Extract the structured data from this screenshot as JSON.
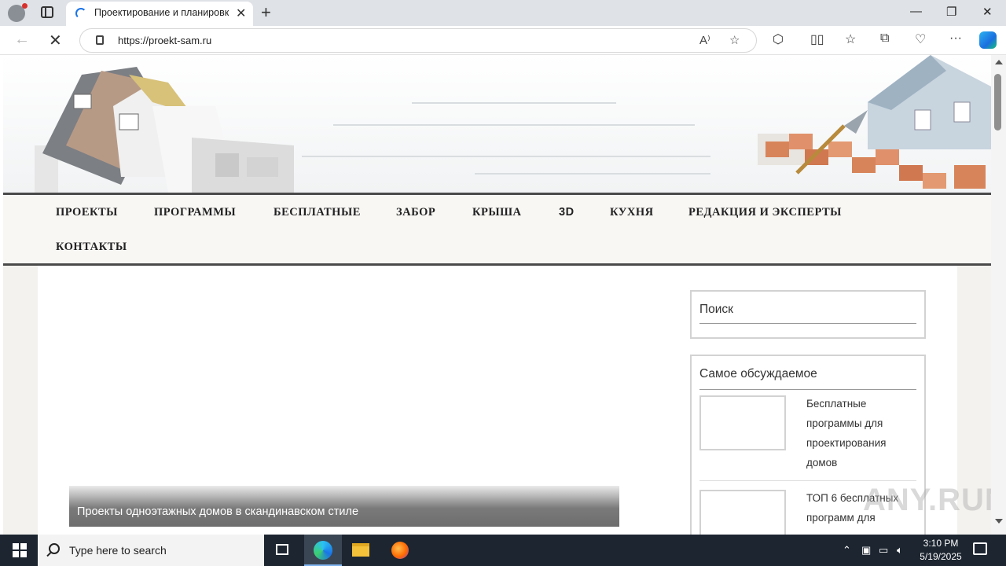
{
  "browser": {
    "tab_title": "Проектирование и планировка",
    "url": "https://proekt-sam.ru"
  },
  "menu": {
    "items": [
      "ПРОЕКТЫ",
      "ПРОГРАММЫ",
      "БЕСПЛАТНЫЕ",
      "ЗАБОР",
      "КРЫША",
      "3D",
      "КУХНЯ",
      "РЕДАКЦИЯ И ЭКСПЕРТЫ",
      "КОНТАКТЫ"
    ]
  },
  "slider": {
    "caption": "Проекты одноэтажных домов в скандинавском стиле"
  },
  "sidebar": {
    "search_title": "Поиск",
    "discussed_title": "Самое обсуждаемое",
    "posts": [
      "Бесплатные программы для проектирования домов",
      "ТОП 6 бесплатных программ для"
    ]
  },
  "watermark": "ANY.RUN",
  "taskbar": {
    "search_placeholder": "Type here to search",
    "time": "3:10 PM",
    "date": "5/19/2025"
  }
}
